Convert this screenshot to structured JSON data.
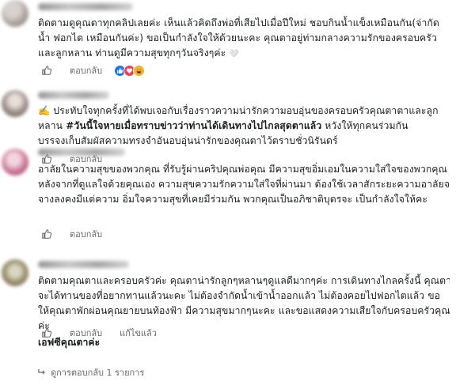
{
  "comments": [
    {
      "lines": [
        "ติดตามดูคุณตาทุกคลิปเลยค่ะ เห็นแล้วคิดถึงพ่อที่เสียไปเมื่อปีใหม่ ชอบกินน้ำแข็งเหมือนกัน(จ่ากัด",
        "น้ำ ฟอกไต เหมือนกันค่ะ) ขอเป็นกำลังใจให้ด้วยนะคะ คุณตาอยู่ท่ามกลางความรักของครอบครัว",
        "และลูกหลาน ท่านดูมีความสุขทุกๆวันจริงๆค่ะ"
      ],
      "trailing_emoji": "🤍",
      "like_label": "",
      "reply_label": "ตอบกลับ"
    },
    {
      "line1": "✍️ ประทับใจทุกครั้งที่ได้พบเจอกับเรื่องราวความน่ารักความอบอุ่นของครอบครัวคุณตาตาและลูก",
      "line2_plain": "หลาน ",
      "line2_bold": "#วันนี้ใจหายเมื่อทราบข่าวว่าท่านได้เดินทางไปไกลสุดตาแล้ว",
      "line2_rest": " หวังให้ทุกคนร่วมกัน",
      "line3": "บรรจงเก็บสัมผัสความทรงจำอันอบอุ่นน่ารักของคุณตาไว้ตราบชั่วนิรันดร์",
      "reply_label": "ตอบกลับ"
    },
    {
      "lines": [
        "อาลัยในความสุขของพวกคุณ ที่รับรู้ผ่านคริปคุณพ่อคุณ มีความสุขอิ่มเอมในความใส่ใจของพวกคุณ",
        "หลังจากที่ดูแลใจด้วยคุณเอง ความสุขความรักความใส่ใจที่ผ่านมา ต้องใช้เวลาสักระยะความอาลัยจะ",
        "จางลงคงมีแต่ความ อิ่มใจความสุขที่เคยมีร่วมกัน พวกคุณเป็นอภิชาติบุตรจะ เป็นกำลังใจให้คะ"
      ],
      "reply_label": "ตอบกลับ"
    },
    {
      "lines": [
        "ติดตามคุณตาและครอบครัวค่ะ คุณตาน่ารักลูกๆหลานๆดูแลดีมากๆค่ะ การเดินทางไกลครั้งนี้ คุณตา",
        "จะได้ทานของที่อยากทานแล้วนะคะ ไม่ต้องจำกัดน้ำเข้าน้ำออกแล้ว ไม่ต้องคอยไปฟอกไตแล้ว ขอ",
        "ให้คุณตาพักผ่อนคุณยายบนท้องฟ้า มีความสุขมากๆนะคะ และขอแสดงความเสียใจกับครอบครัวคุณตา",
        "ค่ะ"
      ],
      "signature": "เอฟซีคุณตาค่ะ",
      "reply_label": "ตอบกลับ",
      "edited_label": "แก้ไขแล้ว"
    }
  ],
  "more_replies": "ดูการตอบกลับ 1 รายการ",
  "colors": {
    "like": "#1877f2",
    "love": "#f33e58",
    "haha": "#f7b125",
    "meta": "#65676b"
  }
}
